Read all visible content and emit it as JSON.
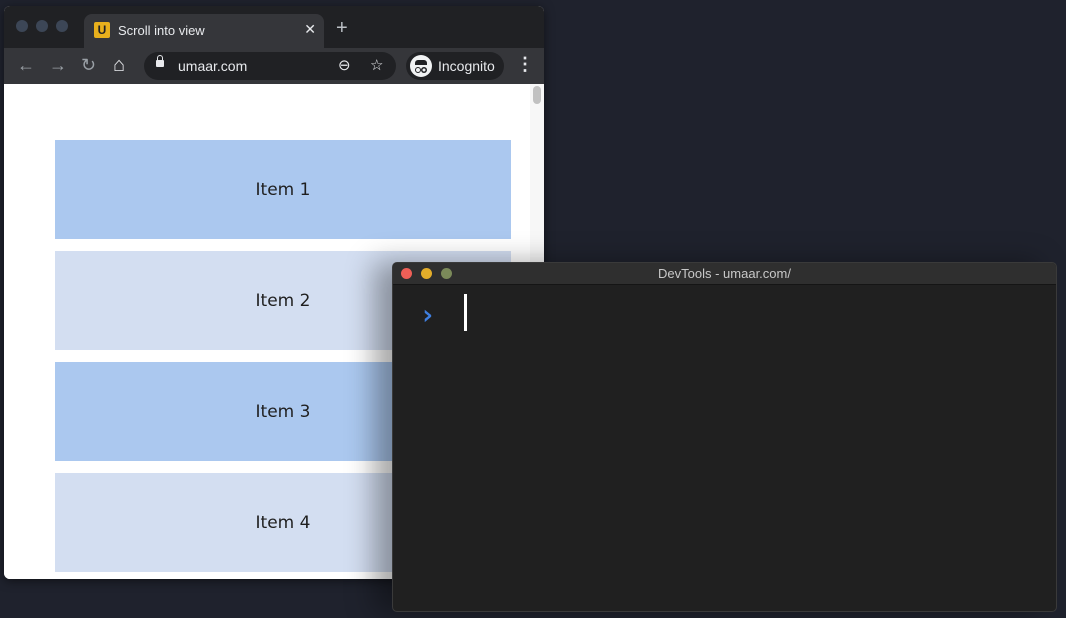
{
  "browser": {
    "tab": {
      "favicon_letter": "U",
      "title": "Scroll into view",
      "close_glyph": "✕"
    },
    "new_tab_glyph": "+",
    "nav": {
      "back_glyph": "←",
      "forward_glyph": "→",
      "reload_glyph": "↻",
      "home_glyph": "⌂"
    },
    "omnibox": {
      "url": "umaar.com",
      "zoom_glyph": "⊖",
      "star_glyph": "☆"
    },
    "incognito_label": "Incognito",
    "menu_glyph": "⋮"
  },
  "page": {
    "items": [
      {
        "label": "Item 1",
        "color": "#abc8ef"
      },
      {
        "label": "Item 2",
        "color": "#d3def1"
      },
      {
        "label": "Item 3",
        "color": "#abc8ef"
      },
      {
        "label": "Item 4",
        "color": "#d3def1"
      }
    ]
  },
  "devtools": {
    "title": "DevTools - umaar.com/",
    "prompt_glyph": "›",
    "traffic_colors": [
      "#ee5f57",
      "#e3ad2a",
      "#7b8a5a"
    ]
  }
}
